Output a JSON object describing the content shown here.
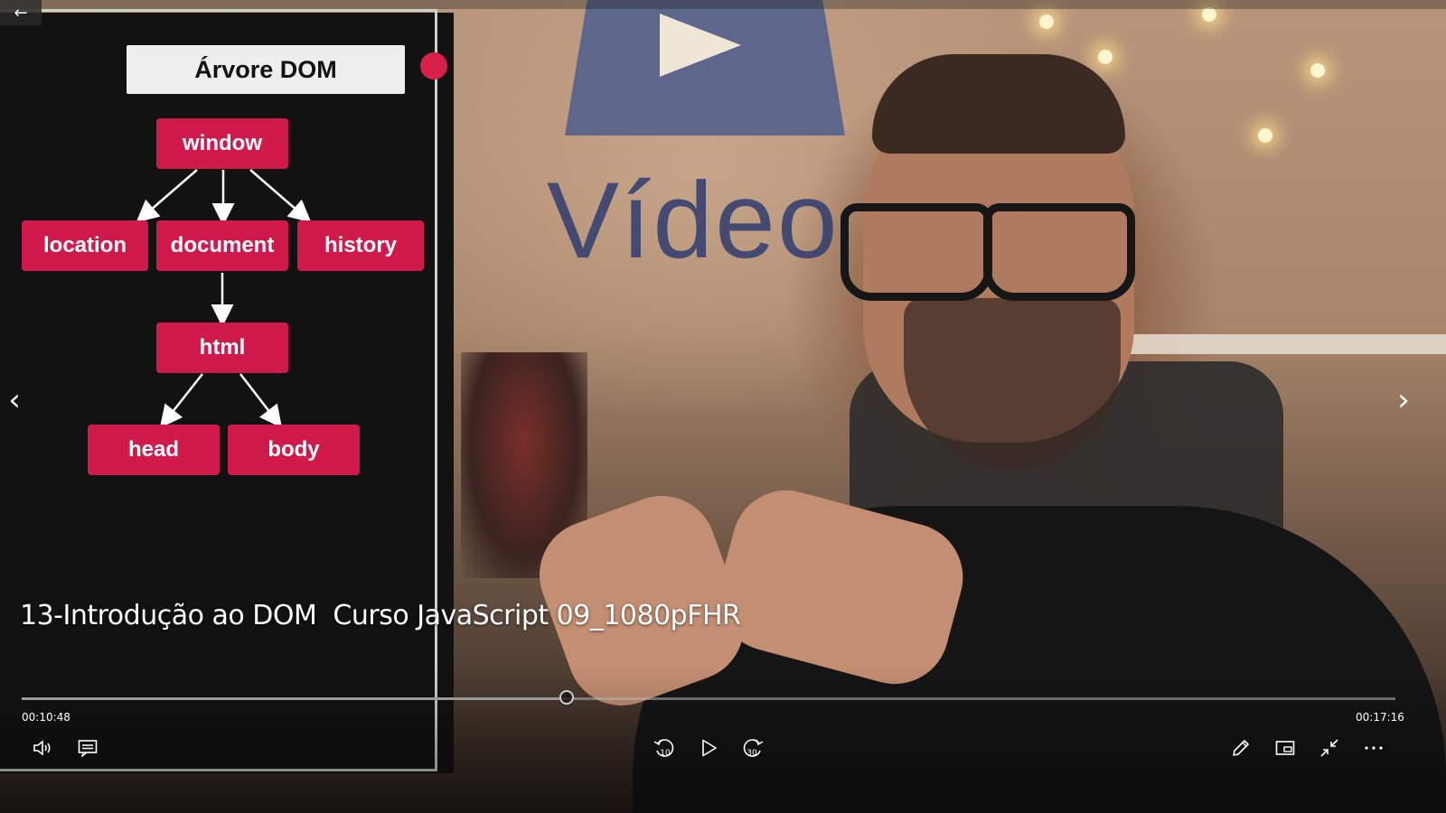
{
  "player": {
    "back_label": "←",
    "title": "13-Introdução ao DOM  Curso JavaScript 09_1080pFHR",
    "current_time": "00:10:48",
    "total_time": "00:17:16",
    "progress_fraction": 0.397,
    "prev_label": "‹",
    "next_label": "›",
    "controls": {
      "volume": "volume-icon",
      "captions": "captions-icon",
      "rewind": "rewind-10-icon",
      "rewind_label": "10",
      "play": "play-icon",
      "forward": "forward-30-icon",
      "forward_label": "30",
      "edit": "pencil-icon",
      "mini_view": "mini-view-icon",
      "exit_fullscreen": "exit-fullscreen-icon",
      "more": "more-icon"
    }
  },
  "slide": {
    "title": "Árvore DOM",
    "nodes": {
      "window": "window",
      "location": "location",
      "document": "document",
      "history": "history",
      "html": "html",
      "head": "head",
      "body": "body"
    },
    "accent_color": "#d11a4c"
  },
  "backdrop": {
    "wall_text": "Vídeo"
  }
}
